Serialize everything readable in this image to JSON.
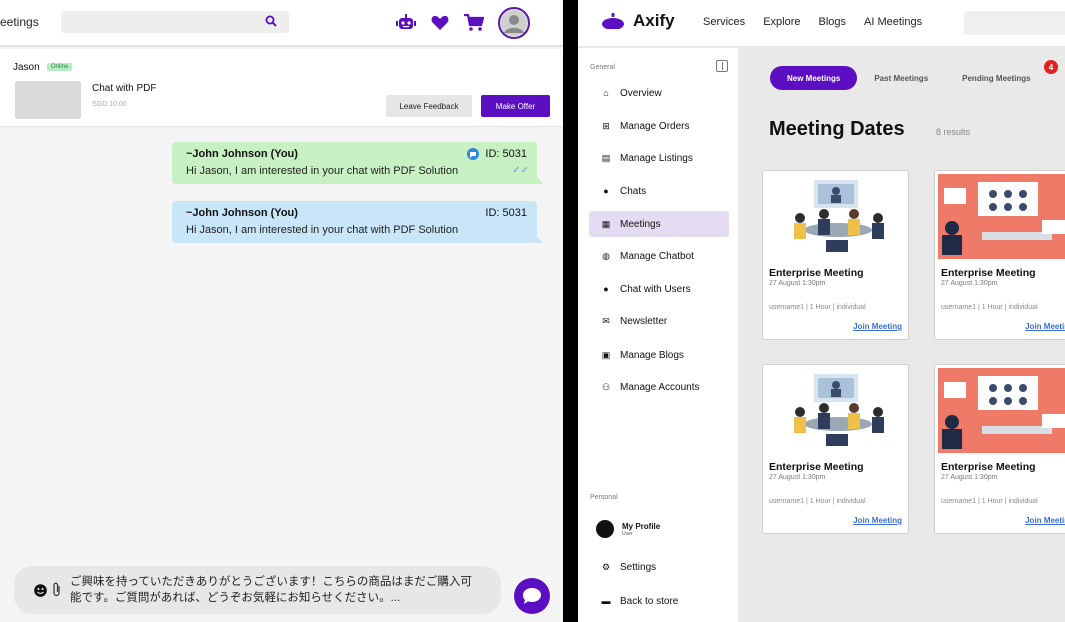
{
  "left": {
    "header": {
      "brand_fragment": "eetings"
    },
    "deal": {
      "user_name": "Jason",
      "status": "Online",
      "title": "Chat with PDF",
      "price": "SGD 10.00",
      "feedback_label": "Leave Feedback",
      "offer_label": "Make Offer"
    },
    "messages": [
      {
        "author": "~John Johnson (You)",
        "id": "ID: 5031",
        "text": "Hi Jason, I am interested in your chat with PDF Solution"
      },
      {
        "author": "~John Johnson (You)",
        "id": "ID: 5031",
        "text": "Hi Jason, I am interested in your chat with PDF Solution"
      }
    ],
    "composer": {
      "text": "ご興味を持っていただきありがとうございます！こちらの商品はまだご購入可能です。ご質問があれば、どうぞお気軽にお知らせください。..."
    }
  },
  "right": {
    "brand": "Axify",
    "nav": [
      "Services",
      "Explore",
      "Blogs",
      "AI Meetings"
    ],
    "sidebar": {
      "general_heading": "General",
      "personal_heading": "Personal",
      "items": [
        {
          "label": "Overview",
          "icon": "home-icon"
        },
        {
          "label": "Manage Orders",
          "icon": "sitemap-icon"
        },
        {
          "label": "Manage Listings",
          "icon": "listings-icon"
        },
        {
          "label": "Chats",
          "icon": "chat-icon"
        },
        {
          "label": "Meetings",
          "icon": "calendar-icon"
        },
        {
          "label": "Manage Chatbot",
          "icon": "robot-icon"
        },
        {
          "label": "Chat with Users",
          "icon": "chat-icon"
        },
        {
          "label": "Newsletter",
          "icon": "envelope-icon"
        },
        {
          "label": "Manage Blogs",
          "icon": "blog-icon"
        },
        {
          "label": "Manage Accounts",
          "icon": "users-icon"
        }
      ],
      "profile_name": "My Profile",
      "profile_role": "User",
      "settings_label": "Settings",
      "back_label": "Back to store"
    },
    "tabs": [
      "New Meetings",
      "Past Meetings",
      "Pending Meetings"
    ],
    "pending_badge": "4",
    "page_title": "Meeting Dates",
    "results": "8 results",
    "cards": [
      {
        "title": "Enterprise Meeting",
        "date": "27 August 1:30pm",
        "meta": "username1 | 1 Hour | individual",
        "join": "Join Meeting",
        "image": "video-conference"
      },
      {
        "title": "Enterprise Meeting",
        "date": "27 August 1:30pm",
        "meta": "username1 | 1 Hour | individual",
        "join": "Join Meeting",
        "image": "red-meeting-room"
      },
      {
        "title": "Enterprise Meeting",
        "date": "27 August 1:30pm",
        "meta": "username1 | 1 Hour | individual",
        "join": "Join Meeting",
        "image": "video-conference"
      },
      {
        "title": "Enterprise Meeting",
        "date": "27 August 1:30pm",
        "meta": "username1 | 1 Hour | individual",
        "join": "Join Meeting",
        "image": "red-meeting-room"
      }
    ]
  },
  "colors": {
    "accent": "#5b0ec2",
    "online_bg": "#b6ecc3",
    "bubble_green": "#c7f0c3",
    "bubble_blue": "#c8e6f7",
    "badge": "#e12222"
  }
}
